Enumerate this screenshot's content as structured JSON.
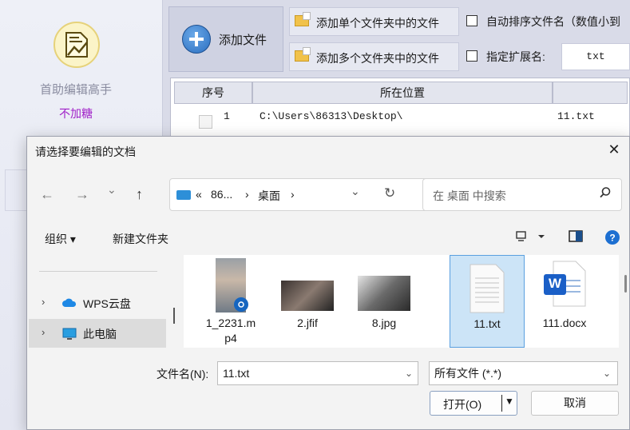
{
  "app": {
    "name": "首助编辑高手",
    "subtitle": "不加糖",
    "add_file_label": "添加文件",
    "add_single_folder": "添加单个文件夹中的文件",
    "add_multi_folder": "添加多个文件夹中的文件",
    "auto_sort_label": "自动排序文件名（数值小到",
    "ext_label": "指定扩展名:",
    "ext_value": "txt",
    "table": {
      "headers": [
        "序号",
        "所在位置"
      ],
      "rows": [
        {
          "index": "1",
          "location": "C:\\Users\\86313\\Desktop\\",
          "name": "11.txt"
        }
      ]
    }
  },
  "dialog": {
    "title": "请选择要编辑的文档",
    "close_glyph": "✕",
    "nav": {
      "back": "←",
      "forward": "→",
      "recent": "⌄",
      "up": "↑"
    },
    "address": {
      "prefix": "«",
      "crumb1": "86...",
      "sep": "›",
      "crumb2": "桌面",
      "sep2": "›",
      "dropdown": "⌄",
      "refresh": "↻"
    },
    "search_placeholder": "在 桌面 中搜索",
    "cmdbar": {
      "organize": "组织 ▾",
      "new_folder": "新建文件夹"
    },
    "tree": [
      {
        "label": "WPS云盘",
        "chev": "›"
      },
      {
        "label": "此电脑",
        "chev": "›"
      }
    ],
    "files": [
      {
        "name": "1_2231.mp4",
        "line1": "1_2231.m",
        "line2": "p4"
      },
      {
        "name": "2.jfif"
      },
      {
        "name": "8.jpg"
      },
      {
        "name": "11.txt"
      },
      {
        "name": "111.docx"
      }
    ],
    "filename_label": "文件名(N):",
    "filename_value": "11.txt",
    "filetype_value": "所有文件 (*.*)",
    "open_label": "打开(O)",
    "cancel_label": "取消",
    "word_badge": "W"
  },
  "colors": {
    "accent": "#2b6fc0",
    "subtitle": "#a020c8",
    "selection": "#cce4f7"
  }
}
